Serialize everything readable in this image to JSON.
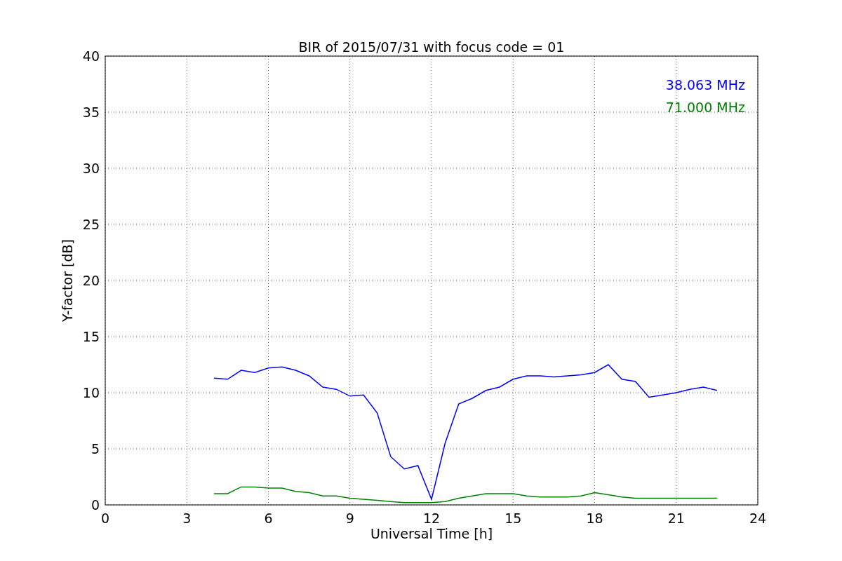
{
  "chart_data": {
    "type": "line",
    "title": "BIR of 2015/07/31 with focus code = 01",
    "xlabel": "Universal Time [h]",
    "ylabel": "Y-factor [dB]",
    "x": [
      4,
      4.5,
      5,
      5.5,
      6,
      6.5,
      7,
      7.5,
      8,
      8.5,
      9,
      9.5,
      10,
      10.5,
      11,
      11.5,
      12,
      12.5,
      13,
      13.5,
      14,
      14.5,
      15,
      15.5,
      16,
      16.5,
      17,
      17.5,
      18,
      18.5,
      19,
      19.5,
      20,
      20.5,
      21,
      21.5,
      22,
      22.5
    ],
    "series": [
      {
        "name": "38.063 MHz",
        "color": "#0000ff",
        "values": [
          11.3,
          11.2,
          12,
          11.8,
          12.2,
          12.3,
          12,
          11.5,
          10.5,
          10.3,
          9.7,
          9.8,
          8.2,
          4.3,
          3.2,
          3.5,
          0.5,
          5.5,
          9,
          9.5,
          10.2,
          10.5,
          11.2,
          11.5,
          11.5,
          11.4,
          11.5,
          11.6,
          11.8,
          12.5,
          11.2,
          11,
          9.6,
          9.8,
          10,
          10.3,
          10.5,
          10.2
        ]
      },
      {
        "name": "71.000 MHz",
        "color": "#008000",
        "values": [
          1,
          1,
          1.6,
          1.6,
          1.5,
          1.5,
          1.2,
          1.1,
          0.8,
          0.8,
          0.6,
          0.5,
          0.4,
          0.3,
          0.2,
          0.2,
          0.2,
          0.3,
          0.6,
          0.8,
          1,
          1,
          1,
          0.8,
          0.7,
          0.7,
          0.7,
          0.8,
          1.1,
          0.9,
          0.7,
          0.6,
          0.6,
          0.6,
          0.6,
          0.6,
          0.6,
          0.6
        ]
      }
    ],
    "grid": true,
    "xlim": [
      0,
      24
    ],
    "ylim": [
      0,
      40
    ],
    "xticks": [
      0,
      3,
      6,
      9,
      12,
      15,
      18,
      21,
      24
    ],
    "yticks": [
      0,
      5,
      10,
      15,
      20,
      25,
      30,
      35,
      40
    ]
  }
}
